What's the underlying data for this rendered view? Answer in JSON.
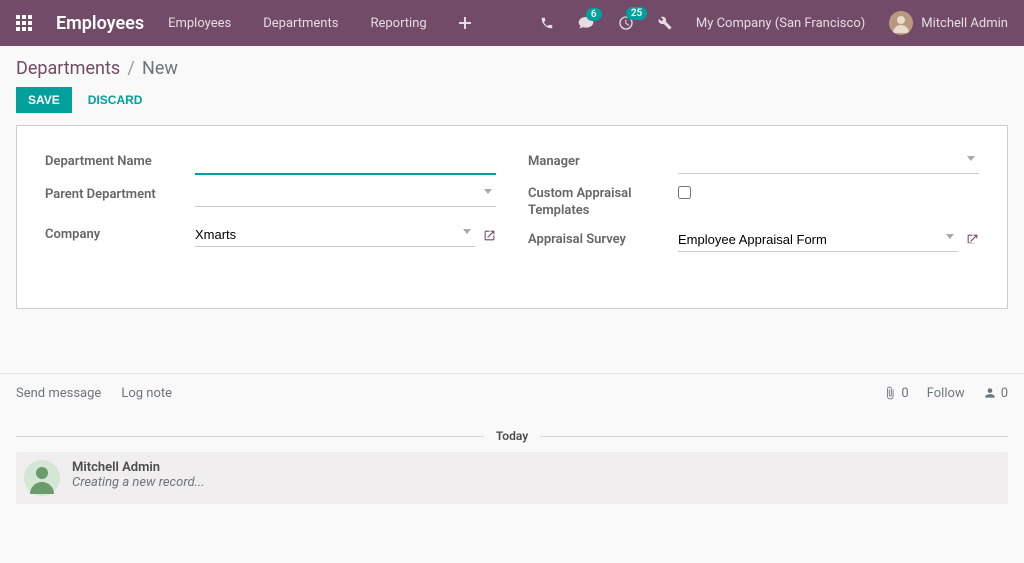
{
  "navbar": {
    "brand": "Employees",
    "menu": [
      "Employees",
      "Departments",
      "Reporting"
    ],
    "badges": {
      "messages": "6",
      "activities": "25"
    },
    "company": "My Company (San Francisco)",
    "user": "Mitchell Admin"
  },
  "breadcrumb": {
    "parent": "Departments",
    "current": "New"
  },
  "actions": {
    "save": "SAVE",
    "discard": "DISCARD"
  },
  "form": {
    "left": {
      "dept_name_label": "Department Name",
      "dept_name_value": "",
      "parent_dept_label": "Parent Department",
      "parent_dept_value": "",
      "company_label": "Company",
      "company_value": "Xmarts"
    },
    "right": {
      "manager_label": "Manager",
      "manager_value": "",
      "custom_tpl_label": "Custom Appraisal Templates",
      "custom_tpl_checked": false,
      "apr_survey_label": "Appraisal Survey",
      "apr_survey_value": "Employee Appraisal Form"
    }
  },
  "chatter": {
    "send_message": "Send message",
    "log_note": "Log note",
    "attach_count": "0",
    "follow": "Follow",
    "followers_count": "0",
    "separator": "Today",
    "msg_author": "Mitchell Admin",
    "msg_text": "Creating a new record..."
  }
}
